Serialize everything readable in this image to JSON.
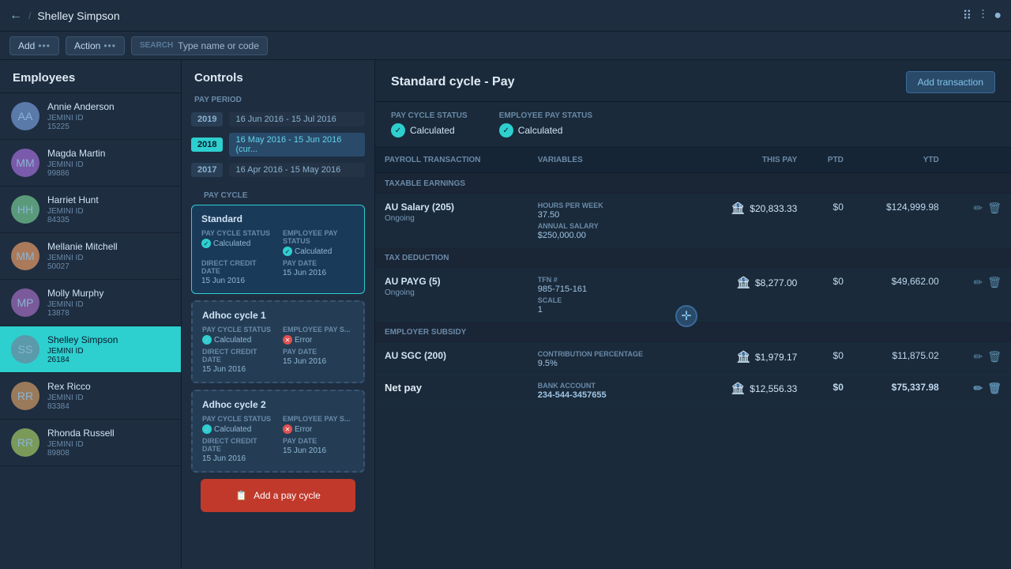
{
  "nav": {
    "back_icon": "←",
    "separator": "/",
    "title": "Shelley Simpson",
    "icons": [
      "≡≡",
      "|||",
      "●"
    ]
  },
  "toolbar": {
    "add_label": "Add",
    "action_label": "Action",
    "dots": "•••",
    "search_label": "SEARCH",
    "search_placeholder": "Type name or code"
  },
  "sidebar": {
    "title": "Employees",
    "employees": [
      {
        "name": "Annie Anderson",
        "id_label": "JEMINI ID",
        "id": "15225",
        "initials": "AA",
        "color": "#5a7aaa"
      },
      {
        "name": "Magda Martin",
        "id_label": "JEMINI ID",
        "id": "99886",
        "initials": "MM",
        "color": "#7a5aaa"
      },
      {
        "name": "Harriet Hunt",
        "id_label": "JEMINI ID",
        "id": "84335",
        "initials": "HH",
        "color": "#5a9a7a"
      },
      {
        "name": "Mellanie Mitchell",
        "id_label": "JEMINI ID",
        "id": "50027",
        "initials": "MM",
        "color": "#aa7a5a"
      },
      {
        "name": "Molly Murphy",
        "id_label": "JEMINI ID",
        "id": "13878",
        "initials": "MP",
        "color": "#7a5a9a"
      },
      {
        "name": "Shelley Simpson",
        "id_label": "JEMINI ID",
        "id": "26184",
        "initials": "SS",
        "color": "#5a9aaa",
        "active": true
      },
      {
        "name": "Rex Ricco",
        "id_label": "JEMINI ID",
        "id": "83384",
        "initials": "RR",
        "color": "#9a7a5a"
      },
      {
        "name": "Rhonda Russell",
        "id_label": "JEMINI ID",
        "id": "89808",
        "initials": "RR",
        "color": "#7a9a5a"
      }
    ]
  },
  "controls": {
    "title": "Controls",
    "pay_period_label": "PAY PERIOD",
    "years": [
      {
        "year": "2019",
        "period": "16 Jun 2016 - 15 Jul 2016",
        "active": false
      },
      {
        "year": "2018",
        "period": "16 May 2016 - 15 Jun 2016 (cur...",
        "active": true
      },
      {
        "year": "2017",
        "period": "16 Apr 2016 - 15 May 2016",
        "active": false
      }
    ],
    "pay_cycle_label": "PAY CYCLE",
    "cycles": [
      {
        "name": "Standard",
        "type": "standard",
        "cycle_status_label": "PAY CYCLE STATUS",
        "cycle_status": "Calculated",
        "emp_status_label": "EMPLOYEE PAY STATUS",
        "emp_status": "Calculated",
        "credit_date_label": "DIRECT CREDIT DATE",
        "credit_date": "15 Jun 2016",
        "pay_date_label": "PAY DATE",
        "pay_date": "15 Jun 2016"
      },
      {
        "name": "Adhoc cycle 1",
        "type": "adhoc",
        "cycle_status_label": "PAY CYCLE STATUS",
        "cycle_status": "Calculated",
        "cycle_status_ok": true,
        "emp_status_label": "EMPLOYEE PAY S...",
        "emp_status": "Error",
        "emp_status_err": true,
        "credit_date_label": "DIRECT CREDIT DATE",
        "credit_date": "15 Jun 2016",
        "pay_date_label": "PAY DATE",
        "pay_date": "15 Jun 2016"
      },
      {
        "name": "Adhoc cycle 2",
        "type": "adhoc",
        "cycle_status_label": "PAY CYCLE STATUS",
        "cycle_status": "Calculated",
        "cycle_status_ok": true,
        "emp_status_label": "EMPLOYEE PAY S...",
        "emp_status": "Error",
        "emp_status_err": true,
        "credit_date_label": "DIRECT CREDIT DATE",
        "credit_date": "15 Jun 2016",
        "pay_date_label": "PAY DATE",
        "pay_date": "15 Jun 2016"
      }
    ],
    "add_cycle_label": "Add a pay cycle"
  },
  "main": {
    "title": "Standard cycle - Pay",
    "add_transaction_label": "Add transaction",
    "pay_cycle_status_label": "PAY CYCLE STATUS",
    "pay_cycle_status": "Calculated",
    "emp_pay_status_label": "EMPLOYEE PAY STATUS",
    "emp_pay_status": "Calculated",
    "table": {
      "headers": [
        "Payroll Transaction",
        "Variables",
        "This pay",
        "PTD",
        "YTD",
        ""
      ],
      "sections": [
        {
          "label": "TAXABLE EARNINGS",
          "rows": [
            {
              "name": "AU Salary (205)",
              "sub": "Ongoing",
              "var1_label": "HOURS PER WEEK",
              "var1_value": "37.50",
              "var2_label": "ANNUAL SALARY",
              "var2_value": "$250,000.00",
              "this_pay": "$20,833.33",
              "ptd": "$0",
              "ytd": "$124,999.98"
            }
          ]
        },
        {
          "label": "TAX DEDUCTION",
          "rows": [
            {
              "name": "AU PAYG (5)",
              "sub": "Ongoing",
              "var1_label": "TFN #",
              "var1_value": "985-715-161",
              "var2_label": "SCALE",
              "var2_value": "1",
              "this_pay": "$8,277.00",
              "ptd": "$0",
              "ytd": "$49,662.00"
            }
          ]
        },
        {
          "label": "EMPLOYER SUBSIDY",
          "rows": [
            {
              "name": "AU SGC (200)",
              "sub": "",
              "var1_label": "CONTRIBUTION PERCENTAGE",
              "var1_value": "9.5%",
              "var2_label": "",
              "var2_value": "",
              "this_pay": "$1,979.17",
              "ptd": "$0",
              "ytd": "$11,875.02"
            }
          ]
        }
      ],
      "net_pay": {
        "label": "Net pay",
        "var_label": "BANK ACCOUNT",
        "var_value": "234-544-3457655",
        "this_pay": "$12,556.33",
        "ptd": "$0",
        "ytd": "$75,337.98"
      }
    }
  }
}
